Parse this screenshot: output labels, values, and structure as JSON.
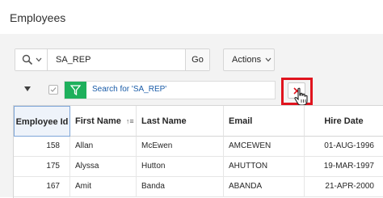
{
  "page": {
    "title": "Employees"
  },
  "toolbar": {
    "search_icon": "search-icon",
    "search_value": "SA_REP",
    "go_label": "Go",
    "actions_label": "Actions"
  },
  "filter": {
    "text": "Search for 'SA_REP'",
    "icon": "filter-icon",
    "remove_icon": "close-icon",
    "remove_color": "#e0141e",
    "highlight_color": "#e0141e",
    "tag_color": "#1eb05c"
  },
  "table": {
    "columns": [
      "Employee Id",
      "First Name",
      "Last Name",
      "Email",
      "Hire Date"
    ],
    "sort_indicator": "↑≡",
    "rows": [
      [
        "158",
        "Allan",
        "McEwen",
        "AMCEWEN",
        "01-AUG-1996"
      ],
      [
        "175",
        "Alyssa",
        "Hutton",
        "AHUTTON",
        "19-MAR-1997"
      ],
      [
        "167",
        "Amit",
        "Banda",
        "ABANDA",
        "21-APR-2000"
      ]
    ]
  }
}
